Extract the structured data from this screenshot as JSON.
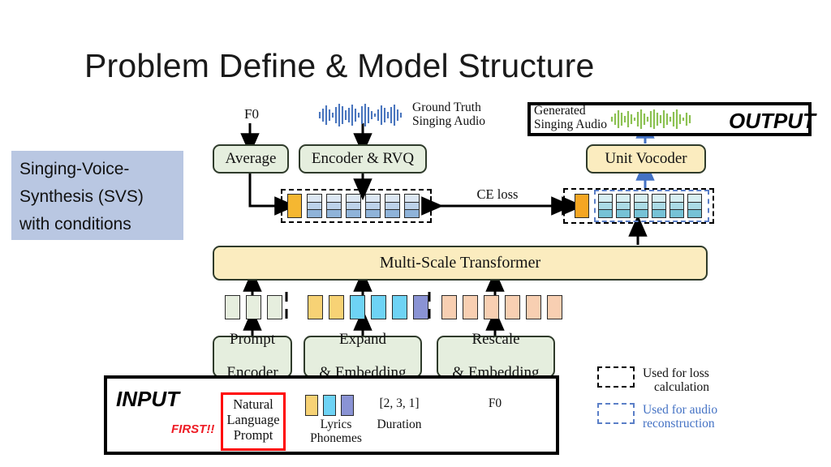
{
  "slide": {
    "title": "Problem Define & Model Structure",
    "background": "#ffffff"
  },
  "callout": {
    "name": "svs-description",
    "background": "#b9c7e2",
    "lines": [
      "Singing-Voice-",
      "Synthesis (SVS)",
      "with conditions"
    ]
  },
  "top_labels": {
    "f0": "F0",
    "ground_truth_audio": [
      "Ground Truth",
      "Singing Audio"
    ],
    "generated_audio": [
      "Generated",
      "Singing Audio"
    ],
    "output_word": "OUTPUT"
  },
  "modules": {
    "average": "Average",
    "encoder_rvq": "Encoder & RVQ",
    "unit_vocoder": "Unit Vocoder",
    "transformer": "Multi-Scale Transformer",
    "prompt_encoder": [
      "Prompt",
      "Encoder"
    ],
    "expand_embedding": [
      "Expand",
      "& Embedding"
    ],
    "rescale_embedding": [
      "Rescale",
      "& Embedding"
    ]
  },
  "loss": {
    "label": "CE loss"
  },
  "token_rows": {
    "left_codes": {
      "prefix_color": "#f5b731",
      "stack_count": 6,
      "stack_layers": 3,
      "stack_colors": [
        "#dce7f3",
        "#bdd2ea",
        "#8fb3d9"
      ]
    },
    "right_codes": {
      "prefix_color": "#f5a623",
      "stack_count": 6,
      "stack_layers": 3,
      "stack_colors": [
        "#d6eef2",
        "#abdbe6",
        "#76c2d6"
      ]
    },
    "prompt_tokens": {
      "count": 3,
      "color": "#e6eede"
    },
    "lyric_tokens": {
      "colors": [
        "#f7d275",
        "#f7d275",
        "#6ed3f5",
        "#6ed3f5",
        "#6ed3f5",
        "#8a93d4"
      ]
    },
    "f0_tokens": {
      "count": 6,
      "color": "#f8cfb2"
    }
  },
  "input_box": {
    "input_word": "INPUT",
    "first_word": "FIRST!!",
    "natural_language_prompt": [
      "Natural",
      "Language",
      "Prompt"
    ],
    "lyrics_phonemes": [
      "Lyrics",
      "Phonemes"
    ],
    "duration_value": "[2, 3, 1]",
    "duration_label": "Duration",
    "f0_label": "F0",
    "phoneme_swatches": [
      "#f7d275",
      "#6ed3f5",
      "#8a93d4"
    ]
  },
  "legend": {
    "items": [
      {
        "style": "black-dashed",
        "color": "#000000",
        "lines": [
          "Used for loss",
          "calculation"
        ]
      },
      {
        "style": "blue-dashed",
        "color": "#4472c4",
        "lines": [
          "Used for audio",
          "reconstruction"
        ]
      }
    ]
  },
  "waveforms": {
    "ground_truth_color": "#4a76be",
    "generated_color": "#8cc152"
  }
}
